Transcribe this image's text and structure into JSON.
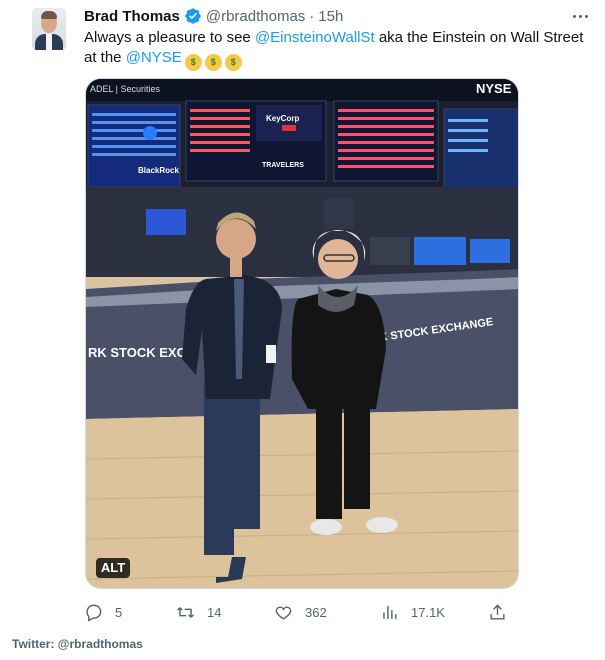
{
  "tweet": {
    "author_name": "Brad Thomas",
    "handle": "@rbradthomas",
    "separator": "·",
    "time": "15h",
    "text_prefix": "Always a pleasure to see ",
    "mention_1": "@EinsteinoWallSt",
    "text_middle": " aka the Einstein on Wall Street at the ",
    "mention_2": "@NYSE",
    "emoji": "money-mouth-face",
    "emoji_count": 3
  },
  "media": {
    "alt_label": "ALT",
    "signs": {
      "blackrock": "BlackRock",
      "keycorp": "KeyCorp",
      "travelers": "TRAVELERS",
      "nyse": "NYSE",
      "securities": "ADEL | Securities",
      "exchange_left": "RK STOCK EXCH",
      "exchange_right": "K STOCK EXCHANGE"
    }
  },
  "actions": {
    "replies": "5",
    "retweets": "14",
    "likes": "362",
    "views": "17.1K"
  },
  "footer": {
    "credit": "Twitter: @rbradthomas"
  },
  "colors": {
    "accent": "#1d9bf0",
    "secondary_text": "#536471",
    "primary_text": "#0f1419"
  }
}
